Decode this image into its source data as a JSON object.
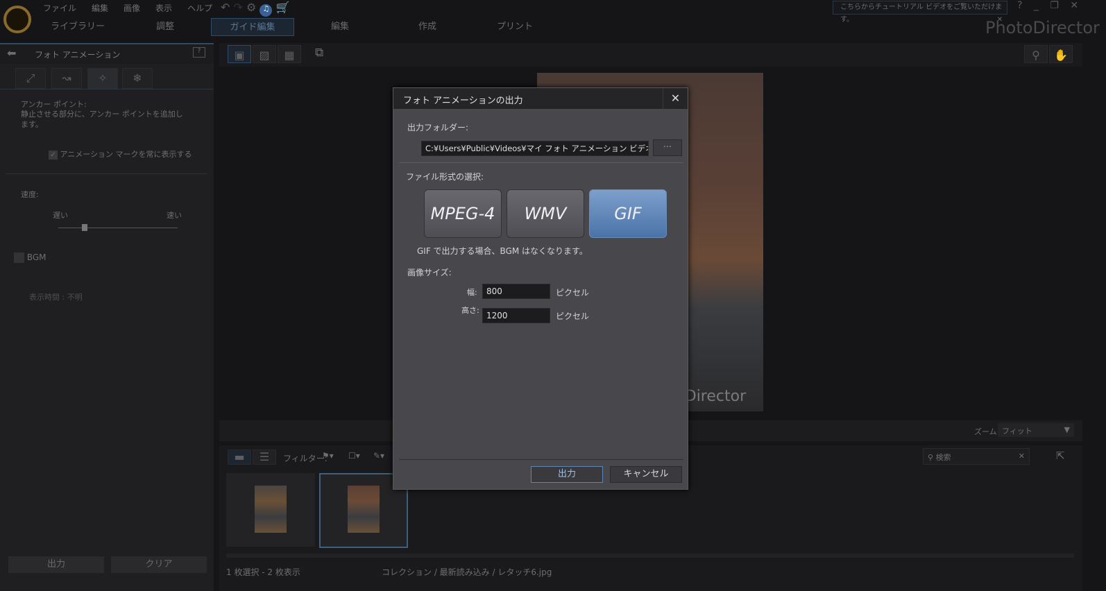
{
  "app": {
    "brand": "PhotoDirector",
    "tooltip": "こちらからチュートリアル ビデオをご覧いただけます。"
  },
  "menu": [
    "ファイル",
    "編集",
    "画像",
    "表示",
    "ヘルプ"
  ],
  "tabs": [
    {
      "label": "ライブラリー"
    },
    {
      "label": "調整"
    },
    {
      "label": "ガイド編集",
      "active": true
    },
    {
      "label": "編集"
    },
    {
      "label": "作成"
    },
    {
      "label": "プリント"
    }
  ],
  "left": {
    "title": "フォト アニメーション",
    "anchor_label": "アンカー ポイント:",
    "anchor_desc": "静止させる部分に、アンカー ポイントを追加します。",
    "show_marks": "アニメーション マークを常に表示する",
    "show_marks_checked": true,
    "speed": "速度:",
    "slow": "遅い",
    "fast": "速い",
    "speed_value": 0.22,
    "bgm": "BGM",
    "bgm_checked": false,
    "duration": "表示時間 : 不明",
    "output": "出力",
    "clear": "クリア"
  },
  "viewer": {
    "watermark": "PhotoDirector",
    "zoom_label": "ズーム:",
    "zoom_value": "フィット"
  },
  "browser": {
    "filter": "フィルター:",
    "search_placeholder": "検索",
    "status": "1 枚選択 - 2 枚表示",
    "path": "コレクション / 最新読み込み / レタッチ6.jpg"
  },
  "dialog": {
    "title": "フォト アニメーションの出力",
    "folder_label": "出力フォルダー:",
    "folder_value": "C:¥Users¥Public¥Videos¥マイ フォト アニメーション ビデオ.gif",
    "browse": "···",
    "format_label": "ファイル形式の選択:",
    "formats": [
      "MPEG-4",
      "WMV",
      "GIF"
    ],
    "selected_format": "GIF",
    "note": "GIF で出力する場合、BGM はなくなります。",
    "size_label": "画像サイズ:",
    "width_label": "幅:",
    "width_value": "800",
    "height_label": "高さ:",
    "height_value": "1200",
    "unit": "ピクセル",
    "ok": "出力",
    "cancel": "キャンセル"
  }
}
